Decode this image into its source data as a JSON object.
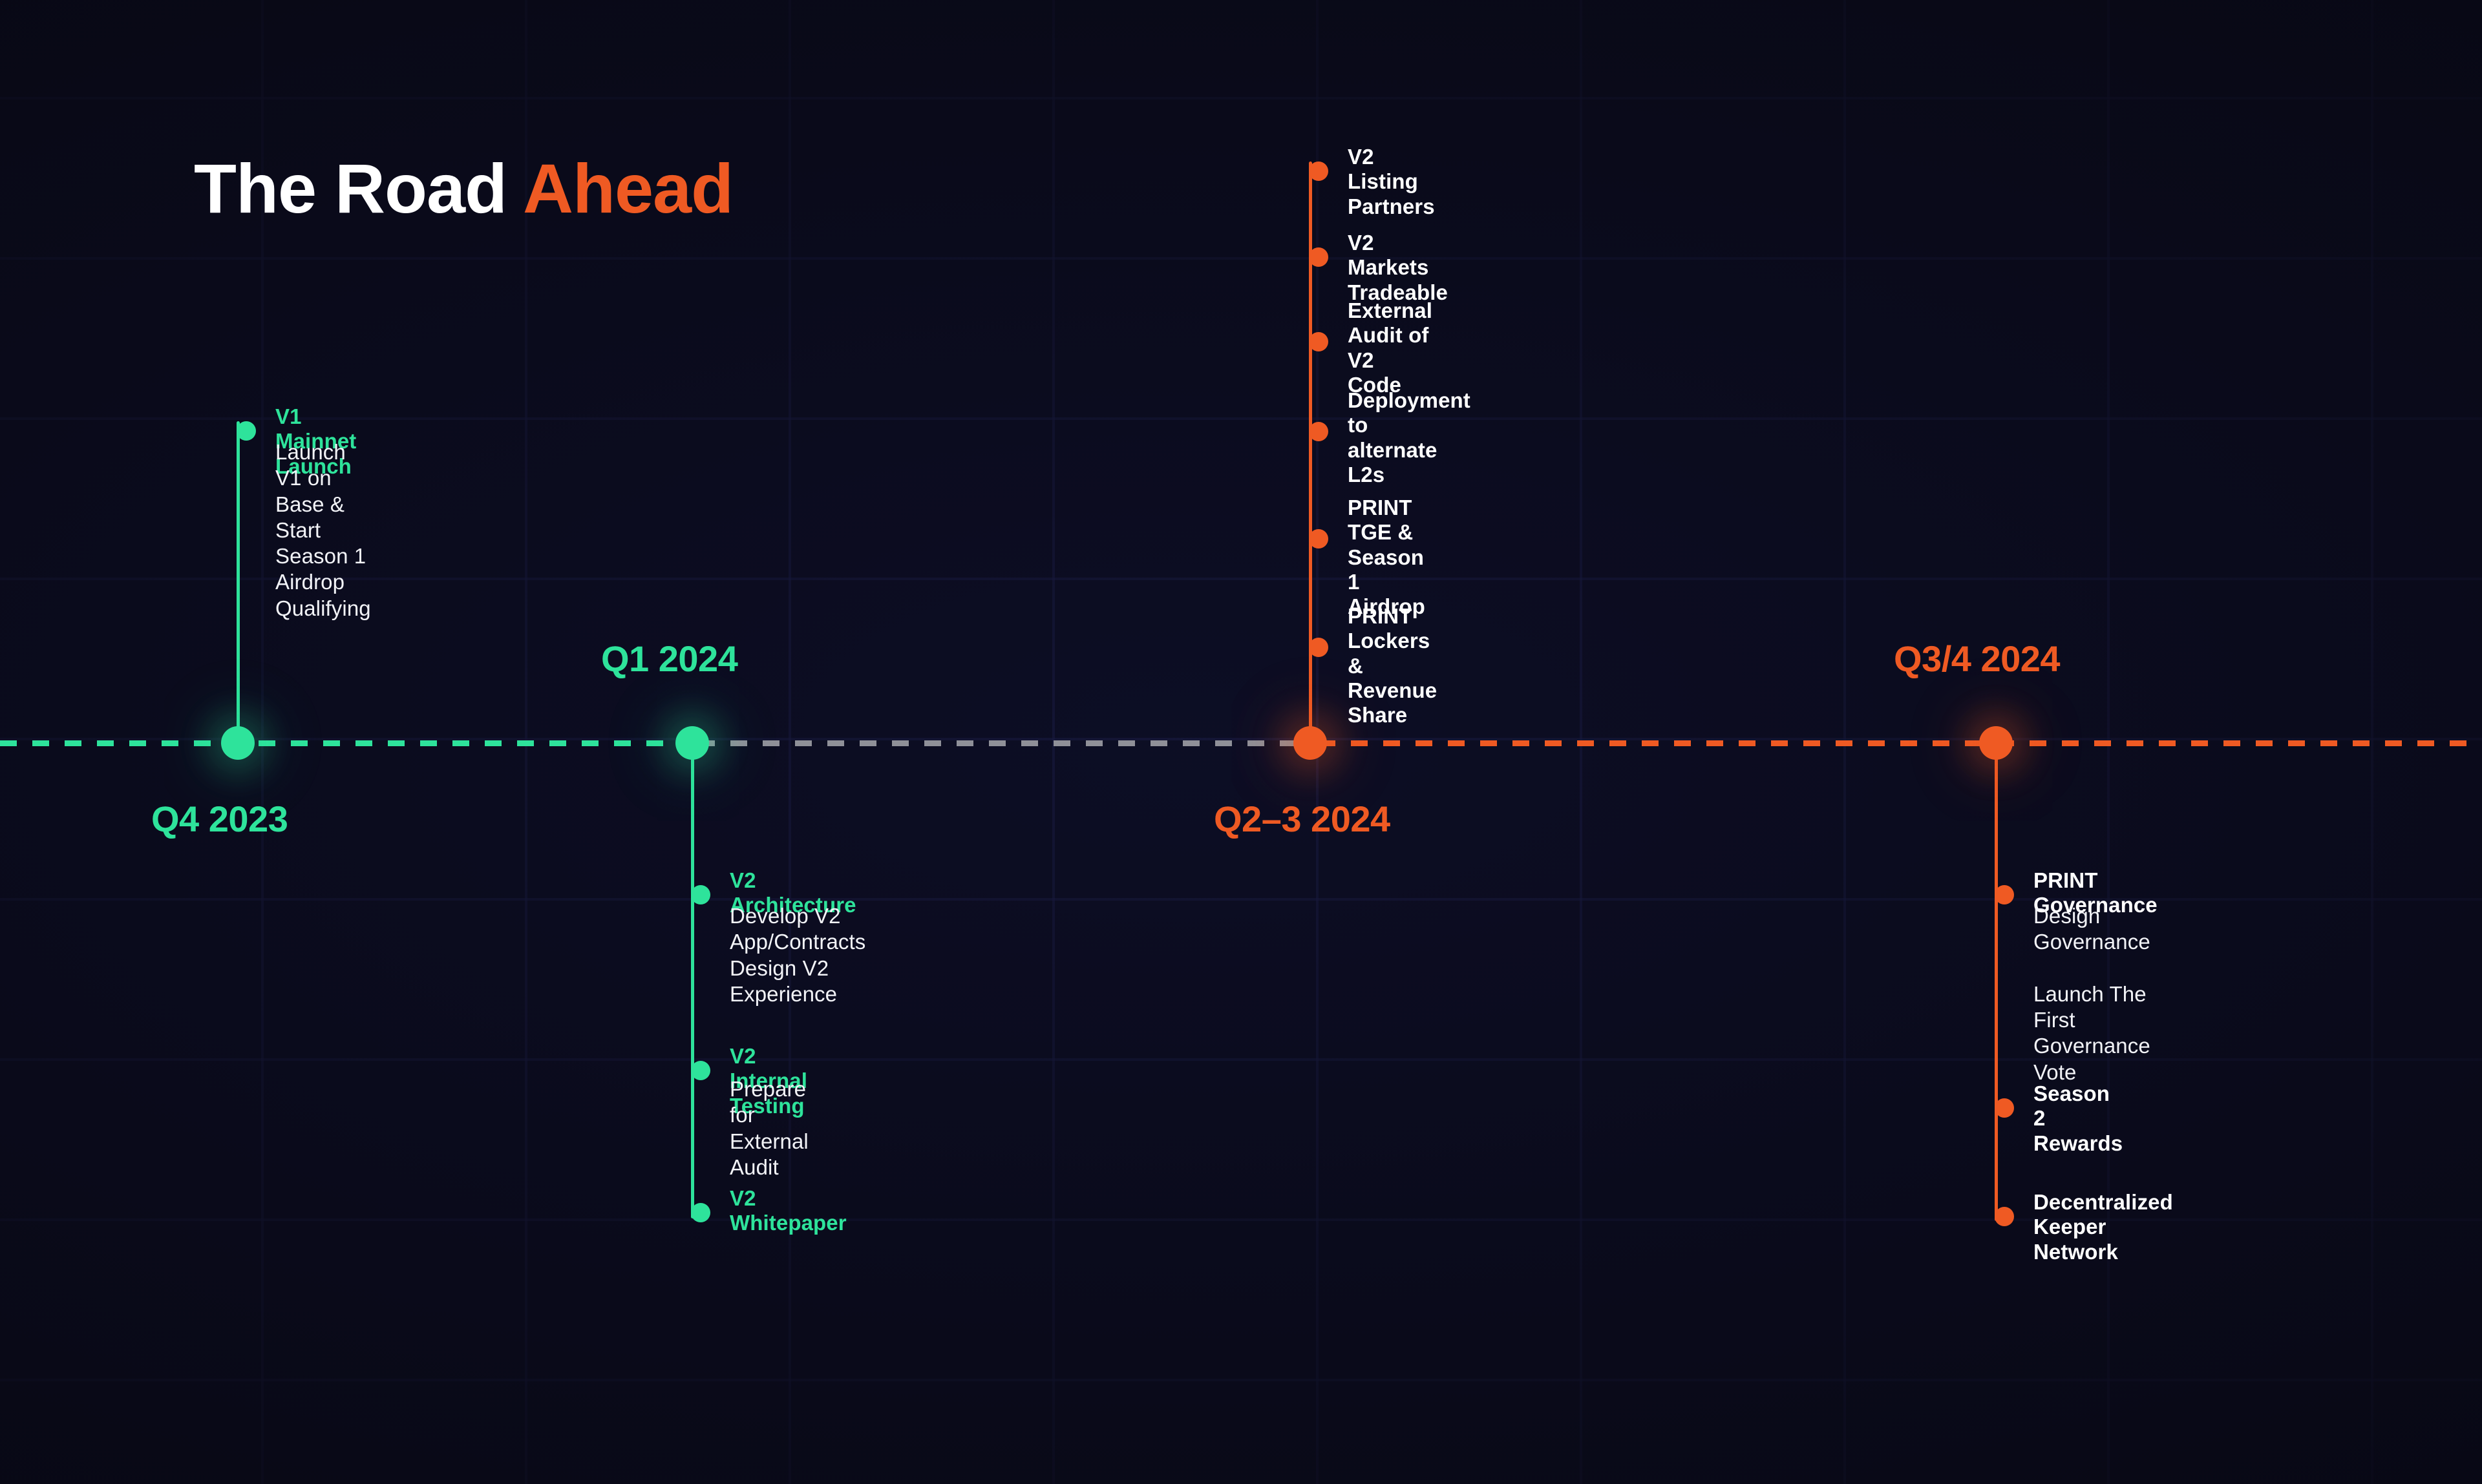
{
  "title": {
    "lead": "The Road ",
    "accent": "Ahead"
  },
  "colors": {
    "background": "#0b0b1a",
    "grid": "#282a5f",
    "green": "#2ee39b",
    "orange": "#ef5a23",
    "axis_mid": "#8f9098",
    "text": "#ffffff"
  },
  "timeline": {
    "phases": [
      {
        "id": "q4-2023",
        "label": "Q4 2023",
        "accent": "green",
        "label_position": "below",
        "items_position": "above",
        "items": [
          {
            "heading": "V1 Mainnet Launch",
            "heading_color": "green",
            "body": "Launch V1 on Base & Start\nSeason 1 Airdrop Qualifying"
          }
        ]
      },
      {
        "id": "q1-2024",
        "label": "Q1 2024",
        "accent": "green",
        "label_position": "above",
        "items_position": "below",
        "items": [
          {
            "heading": "V2 Architecture",
            "heading_color": "green",
            "body": "Develop V2 App/Contracts\nDesign V2 Experience"
          },
          {
            "heading": "V2 Internal Testing",
            "heading_color": "green",
            "body": "Prepare for External Audit"
          },
          {
            "heading": "V2 Whitepaper",
            "heading_color": "green",
            "body": ""
          }
        ]
      },
      {
        "id": "q2-3-2024",
        "label": "Q2–3 2024",
        "accent": "orange",
        "label_position": "below",
        "items_position": "above",
        "items": [
          {
            "heading": "V2 Listing Partners",
            "heading_color": "white",
            "body": ""
          },
          {
            "heading": "V2 Markets Tradeable",
            "heading_color": "white",
            "body": ""
          },
          {
            "heading": "External Audit of\nV2 Code",
            "heading_color": "white",
            "body": ""
          },
          {
            "heading": "Deployment to\nalternate L2s",
            "heading_color": "white",
            "body": ""
          },
          {
            "heading": "PRINT TGE & Season 1\nAirdrop",
            "heading_color": "white",
            "body": ""
          },
          {
            "heading": "PRINT Lockers &\nRevenue Share",
            "heading_color": "white",
            "body": ""
          }
        ]
      },
      {
        "id": "q3-4-2024",
        "label": "Q3/4 2024",
        "accent": "orange",
        "label_position": "above",
        "items_position": "below",
        "items": [
          {
            "heading": "PRINT Governance",
            "heading_color": "white",
            "body": "Design Governance\n\nLaunch The First\nGovernance Vote"
          },
          {
            "heading": "Season 2 Rewards",
            "heading_color": "white",
            "body": ""
          },
          {
            "heading": "Decentralized Keeper\nNetwork",
            "heading_color": "white",
            "body": ""
          }
        ]
      }
    ]
  }
}
